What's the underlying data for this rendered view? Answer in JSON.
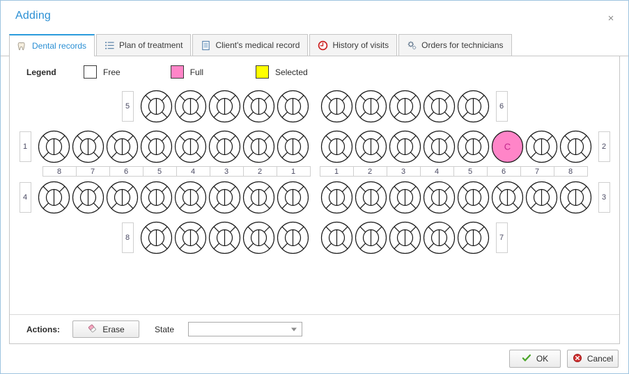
{
  "window": {
    "title": "Adding",
    "close_label": "×",
    "close_icon": "close-icon",
    "accent_color": "#2a8fd4"
  },
  "tabs": [
    {
      "label": "Dental records",
      "icon": "tooth-icon",
      "active": true
    },
    {
      "label": "Plan of treatment",
      "icon": "list-icon",
      "active": false
    },
    {
      "label": "Client's medical record",
      "icon": "document-icon",
      "active": false
    },
    {
      "label": "History of visits",
      "icon": "clock-history-icon",
      "active": false
    },
    {
      "label": "Orders for technicians",
      "icon": "gears-icon",
      "active": false
    }
  ],
  "legend": {
    "title": "Legend",
    "items": [
      {
        "label": "Free",
        "color": "#ffffff"
      },
      {
        "label": "Full",
        "color": "#ff85c8"
      },
      {
        "label": "Selected",
        "color": "#ffff00"
      }
    ]
  },
  "chart": {
    "quadrant_labels": {
      "deciduous_upper_left": "5",
      "deciduous_upper_right": "6",
      "permanent_upper_left": "1",
      "permanent_upper_right": "2",
      "permanent_lower_left": "4",
      "permanent_lower_right": "3",
      "deciduous_lower_left": "8",
      "deciduous_lower_right": "7"
    },
    "number_strip_left": [
      "8",
      "7",
      "6",
      "5",
      "4",
      "3",
      "2",
      "1"
    ],
    "number_strip_right": [
      "1",
      "2",
      "3",
      "4",
      "5",
      "6",
      "7",
      "8"
    ],
    "rows": [
      {
        "name": "deciduous-upper",
        "left": [
          {
            "state": "free",
            "label": ""
          },
          {
            "state": "free",
            "label": ""
          },
          {
            "state": "free",
            "label": ""
          },
          {
            "state": "free",
            "label": ""
          },
          {
            "state": "free",
            "label": ""
          }
        ],
        "right": [
          {
            "state": "free",
            "label": ""
          },
          {
            "state": "free",
            "label": ""
          },
          {
            "state": "free",
            "label": ""
          },
          {
            "state": "free",
            "label": ""
          },
          {
            "state": "free",
            "label": ""
          }
        ]
      },
      {
        "name": "permanent-upper",
        "left": [
          {
            "state": "free",
            "label": ""
          },
          {
            "state": "free",
            "label": ""
          },
          {
            "state": "free",
            "label": ""
          },
          {
            "state": "free",
            "label": ""
          },
          {
            "state": "free",
            "label": ""
          },
          {
            "state": "free",
            "label": ""
          },
          {
            "state": "free",
            "label": ""
          },
          {
            "state": "free",
            "label": ""
          }
        ],
        "right": [
          {
            "state": "free",
            "label": ""
          },
          {
            "state": "free",
            "label": ""
          },
          {
            "state": "free",
            "label": ""
          },
          {
            "state": "free",
            "label": ""
          },
          {
            "state": "free",
            "label": ""
          },
          {
            "state": "full",
            "label": "C"
          },
          {
            "state": "free",
            "label": ""
          },
          {
            "state": "free",
            "label": ""
          }
        ]
      },
      {
        "name": "permanent-lower",
        "left": [
          {
            "state": "free",
            "label": ""
          },
          {
            "state": "free",
            "label": ""
          },
          {
            "state": "free",
            "label": ""
          },
          {
            "state": "free",
            "label": ""
          },
          {
            "state": "free",
            "label": ""
          },
          {
            "state": "free",
            "label": ""
          },
          {
            "state": "free",
            "label": ""
          },
          {
            "state": "free",
            "label": ""
          }
        ],
        "right": [
          {
            "state": "free",
            "label": ""
          },
          {
            "state": "free",
            "label": ""
          },
          {
            "state": "free",
            "label": ""
          },
          {
            "state": "free",
            "label": ""
          },
          {
            "state": "free",
            "label": ""
          },
          {
            "state": "free",
            "label": ""
          },
          {
            "state": "free",
            "label": ""
          },
          {
            "state": "free",
            "label": ""
          }
        ]
      },
      {
        "name": "deciduous-lower",
        "left": [
          {
            "state": "free",
            "label": ""
          },
          {
            "state": "free",
            "label": ""
          },
          {
            "state": "free",
            "label": ""
          },
          {
            "state": "free",
            "label": ""
          },
          {
            "state": "free",
            "label": ""
          }
        ],
        "right": [
          {
            "state": "free",
            "label": ""
          },
          {
            "state": "free",
            "label": ""
          },
          {
            "state": "free",
            "label": ""
          },
          {
            "state": "free",
            "label": ""
          },
          {
            "state": "free",
            "label": ""
          }
        ]
      }
    ]
  },
  "actions": {
    "label": "Actions:",
    "erase_label": "Erase",
    "erase_icon": "eraser-icon",
    "state_label": "State",
    "state_value": "",
    "state_placeholder": ""
  },
  "footer": {
    "ok_label": "OK",
    "ok_icon": "check-icon",
    "cancel_label": "Cancel",
    "cancel_icon": "cancel-icon"
  }
}
